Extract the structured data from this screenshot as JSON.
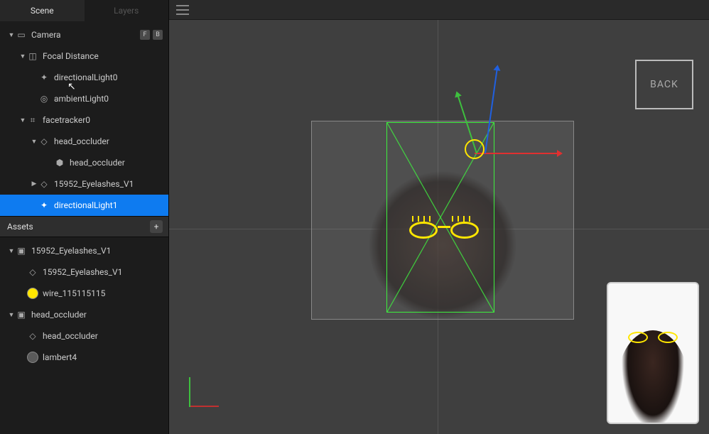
{
  "tabs": {
    "scene": "Scene",
    "layers": "Layers"
  },
  "tree": {
    "camera": {
      "label": "Camera",
      "badge_f": "F",
      "badge_b": "B"
    },
    "focal_distance": "Focal Distance",
    "directionalLight0": "directionalLight0",
    "ambientLight0": "ambientLight0",
    "facetracker0": "facetracker0",
    "head_occluder_group": "head_occluder",
    "head_occluder_child": "head_occluder",
    "eyelashes_obj": "15952_Eyelashes_V1",
    "directionalLight1": "directionalLight1"
  },
  "assets_header": "Assets",
  "assets": {
    "eyelashes_folder": "15952_Eyelashes_V1",
    "eyelashes_mesh": "15952_Eyelashes_V1",
    "wire_mat": "wire_115115115",
    "head_folder": "head_occluder",
    "head_mesh": "head_occluder",
    "lambert4": "lambert4"
  },
  "viewport": {
    "back_label": "BACK"
  }
}
